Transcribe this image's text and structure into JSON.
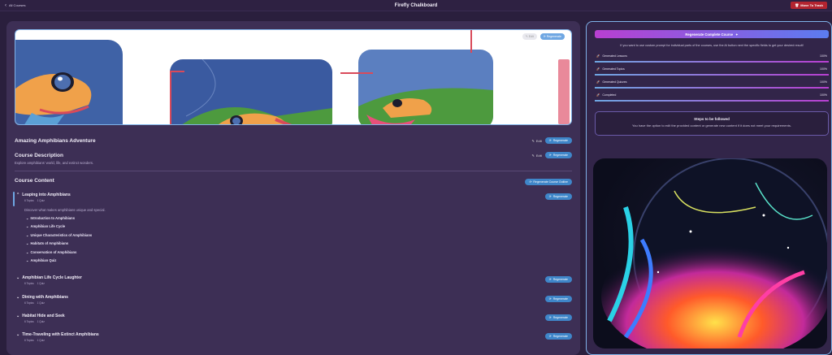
{
  "topbar": {
    "back_label": "All Courses",
    "title": "Firefly Chalkboard",
    "trash_label": "Move To Trash"
  },
  "banner": {
    "edit_label": "Edit",
    "regenerate_label": "Regenerate"
  },
  "course": {
    "title": "Amazing Amphibians Adventure",
    "edit_label": "Edit",
    "regenerate_label": "Regenerate",
    "description_heading": "Course Description",
    "description": "Explore amphibians' world, life, and extinct wonders.",
    "content_heading": "Course Content",
    "outline_button": "Regenerate Course Outline"
  },
  "modules": [
    {
      "title": "Leaping into Amphibians",
      "topics": "6 Topics",
      "quiz": "1 Quiz",
      "description": "Discover what makes amphibians unique and special.",
      "lessons": [
        "Introduction to Amphibians",
        "Amphibian Life Cycle",
        "Unique Characteristics of Amphibians",
        "Habitats of Amphibians",
        "Conservation of Amphibians",
        "Amphibian Quiz"
      ],
      "regenerate_label": "Regenerate"
    },
    {
      "title": "Amphibian Life Cycle Laughter",
      "topics": "6 Topics",
      "quiz": "1 Quiz",
      "regenerate_label": "Regenerate"
    },
    {
      "title": "Dining with Amphibians",
      "topics": "6 Topics",
      "quiz": "1 Quiz",
      "regenerate_label": "Regenerate"
    },
    {
      "title": "Habitat Hide and Seek",
      "topics": "6 Topics",
      "quiz": "1 Quiz",
      "regenerate_label": "Regenerate"
    },
    {
      "title": "Time-Traveling with Extinct Amphibians",
      "topics": "6 Topics",
      "quiz": "1 Quiz",
      "regenerate_label": "Regenerate"
    }
  ],
  "sidebar": {
    "regenerate_course": "Regenerate Complete Course",
    "note": "If you want to use custom prompt for individual parts of the courses, use the AI button next the specific fields to get your desired result!",
    "stats": [
      {
        "label": "Generated Lessons",
        "value": "100%"
      },
      {
        "label": "Generated Topics",
        "value": "100%"
      },
      {
        "label": "Generated Quizzes",
        "value": "100%"
      },
      {
        "label": "Completed",
        "value": "100%"
      }
    ],
    "steps_title": "Steps to be followed",
    "steps_text": "You have the option to edit the provided content or generate new content if it does not meet your requirements."
  },
  "colors": {
    "accent_blue": "#3f86c9",
    "trash_red": "#b32430",
    "panel_bg": "#3d2f55"
  }
}
